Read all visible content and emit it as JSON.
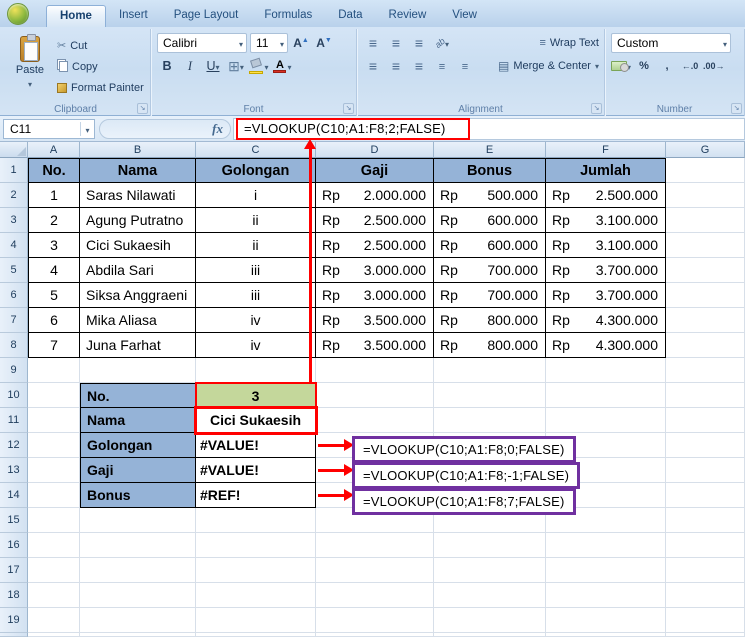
{
  "colors": {
    "annotation_red": "#FF0000",
    "callout_purple": "#7030A0",
    "header_blue": "#95B3D7",
    "value_green": "#C4D79B"
  },
  "ribbon": {
    "tabs": [
      {
        "label": "Home",
        "active": true
      },
      {
        "label": "Insert",
        "active": false
      },
      {
        "label": "Page Layout",
        "active": false
      },
      {
        "label": "Formulas",
        "active": false
      },
      {
        "label": "Data",
        "active": false
      },
      {
        "label": "Review",
        "active": false
      },
      {
        "label": "View",
        "active": false
      }
    ],
    "clipboard": {
      "label": "Clipboard",
      "paste": "Paste",
      "cut": "Cut",
      "copy": "Copy",
      "format_painter": "Format Painter"
    },
    "font": {
      "label": "Font",
      "name": "Calibri",
      "size": "11",
      "bold": "B",
      "italic": "I",
      "underline": "U"
    },
    "alignment": {
      "label": "Alignment",
      "wrap_text": "Wrap Text",
      "merge_center": "Merge & Center",
      "orientation_glyph": "ab"
    },
    "number": {
      "label": "Number",
      "format": "Custom",
      "percent": "%",
      "comma": ",",
      "increase_decimal": "←.0",
      "decrease_decimal": ".00→"
    }
  },
  "formula_bar": {
    "name_box": "C11",
    "fx": "fx",
    "formula": "=VLOOKUP(C10;A1:F8;2;FALSE)"
  },
  "sheet": {
    "columns": [
      "A",
      "B",
      "C",
      "D",
      "E",
      "F",
      "G"
    ],
    "rows": 19,
    "currency_prefix": "Rp",
    "table": {
      "headers": [
        "No.",
        "Nama",
        "Golongan",
        "Gaji",
        "Bonus",
        "Jumlah"
      ],
      "data": [
        [
          "1",
          "Saras Nilawati",
          "i",
          "2.000.000",
          "500.000",
          "2.500.000"
        ],
        [
          "2",
          "Agung Putratno",
          "ii",
          "2.500.000",
          "600.000",
          "3.100.000"
        ],
        [
          "3",
          "Cici Sukaesih",
          "ii",
          "2.500.000",
          "600.000",
          "3.100.000"
        ],
        [
          "4",
          "Abdila Sari",
          "iii",
          "3.000.000",
          "700.000",
          "3.700.000"
        ],
        [
          "5",
          "Siksa Anggraeni",
          "iii",
          "3.000.000",
          "700.000",
          "3.700.000"
        ],
        [
          "6",
          "Mika Aliasa",
          "iv",
          "3.500.000",
          "800.000",
          "4.300.000"
        ],
        [
          "7",
          "Juna Farhat",
          "iv",
          "3.500.000",
          "800.000",
          "4.300.000"
        ]
      ]
    },
    "lookup": [
      {
        "row": 10,
        "label": "No.",
        "value": "3",
        "style": "green"
      },
      {
        "row": 11,
        "label": "Nama",
        "value": "Cici Sukaesih",
        "style": "result"
      },
      {
        "row": 12,
        "label": "Golongan",
        "value": "#VALUE!",
        "style": "error"
      },
      {
        "row": 13,
        "label": "Gaji",
        "value": "#VALUE!",
        "style": "error"
      },
      {
        "row": 14,
        "label": "Bonus",
        "value": "#REF!",
        "style": "error"
      }
    ],
    "callouts": [
      "=VLOOKUP(C10;A1:F8;0;FALSE)",
      "=VLOOKUP(C10;A1:F8;-1;FALSE)",
      "=VLOOKUP(C10;A1:F8;7;FALSE)"
    ]
  }
}
